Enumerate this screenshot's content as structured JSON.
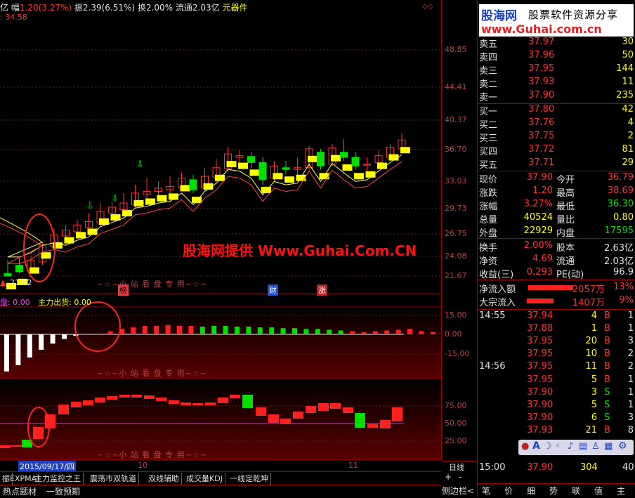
{
  "topinfo": {
    "prefix": "亿",
    "amp_label": "幅",
    "amp_value": "1.20(3.27%)",
    "zhen": "振2.39(6.51%)",
    "huan": "换2.00%",
    "liutong": "流通2.03亿",
    "sector": "元器件",
    "price_tag": ": 34.58"
  },
  "axis_main": [
    "48.85",
    "44.41",
    "40.37",
    "36.70",
    "33.03",
    "29.73",
    "26.75",
    "24.08",
    "21.67"
  ],
  "axis_mid": [
    "15.00",
    "0.00",
    "-15.00"
  ],
  "axis_low": [
    "75.00",
    "50.00",
    "25.00"
  ],
  "chart_labels": {
    "low_price": "21.02",
    "watermark1": "~☆~小 站 看 盘 专 用~☆~",
    "watermark2": "~☆~小 站 看 盘 专 用~☆~",
    "watermark3": "~☆~小 站 看 盘 专 用~☆~",
    "badge_bang": "榜",
    "badge_cai": "财",
    "badge_zhang": "涨",
    "mid_label1": "盘: 0.00",
    "mid_label2": "主力出货: 0.00",
    "ad_text": "股海网提供 Www.Guhai.Com.CN",
    "date_label": "2015/09/17/四",
    "month_10": "10",
    "month_11": "11",
    "period": "日线"
  },
  "logo": {
    "main": "股海网",
    "sub": "股票软件资源分享",
    "url": "www.Guhai.com.cn"
  },
  "asks": [
    {
      "label": "卖五",
      "price": "37.97",
      "vol": "30"
    },
    {
      "label": "卖四",
      "price": "37.96",
      "vol": "50"
    },
    {
      "label": "卖三",
      "price": "37.95",
      "vol": "144"
    },
    {
      "label": "卖二",
      "price": "37.93",
      "vol": "11"
    },
    {
      "label": "卖一",
      "price": "37.90",
      "vol": "235"
    }
  ],
  "bids": [
    {
      "label": "买一",
      "price": "37.80",
      "vol": "42"
    },
    {
      "label": "买二",
      "price": "37.76",
      "vol": "4"
    },
    {
      "label": "买三",
      "price": "37.75",
      "vol": "2"
    },
    {
      "label": "买四",
      "price": "37.72",
      "vol": "81"
    },
    {
      "label": "买五",
      "price": "37.71",
      "vol": "29"
    }
  ],
  "stats": [
    {
      "l1": "现价",
      "v1": "37.90",
      "l2": "今开",
      "v2": "36.79"
    },
    {
      "l1": "涨跌",
      "v1": "1.20",
      "l2": "最高",
      "v2": "38.69"
    },
    {
      "l1": "涨幅",
      "v1": "3.27%",
      "l2": "最低",
      "v2": "36.30"
    },
    {
      "l1": "总量",
      "v1": "40524",
      "l2": "量比",
      "v2": "0.80"
    },
    {
      "l1": "外盘",
      "v1": "22929",
      "l2": "内盘",
      "v2": "17595"
    }
  ],
  "stats2": [
    {
      "l1": "换手",
      "v1": "2.00%",
      "l2": "股本",
      "v2": "2.63亿"
    },
    {
      "l1": "净资",
      "v1": "4.69",
      "l2": "流通",
      "v2": "2.03亿"
    },
    {
      "l1": "收益(三)",
      "v1": "0.293",
      "l2": "PE(动)",
      "v2": "96.9"
    }
  ],
  "flows": [
    {
      "label": "净流入额",
      "amount": "2057万",
      "pct": "13%"
    },
    {
      "label": "大宗流入",
      "amount": "1407万",
      "pct": "9%"
    }
  ],
  "ticks": [
    {
      "time": "14:55",
      "price": "37.94",
      "vol": "4",
      "side": "B",
      "num": "1"
    },
    {
      "time": "",
      "price": "37.88",
      "vol": "1",
      "side": "B",
      "num": "1"
    },
    {
      "time": "",
      "price": "37.95",
      "vol": "20",
      "side": "B",
      "num": "3"
    },
    {
      "time": "",
      "price": "37.95",
      "vol": "10",
      "side": "B",
      "num": "2"
    },
    {
      "time": "14:56",
      "price": "37.95",
      "vol": "11",
      "side": "B",
      "num": "2"
    },
    {
      "time": "",
      "price": "37.95",
      "vol": "5",
      "side": "B",
      "num": "1"
    },
    {
      "time": "",
      "price": "37.90",
      "vol": "3",
      "side": "S",
      "num": "1"
    },
    {
      "time": "",
      "price": "37.90",
      "vol": "5",
      "side": "S",
      "num": "1"
    },
    {
      "time": "",
      "price": "37.90",
      "vol": "6",
      "side": "S",
      "num": "3"
    },
    {
      "time": "",
      "price": "37.93",
      "vol": "21",
      "side": "B",
      "num": "8"
    }
  ],
  "last_tick": {
    "time": "15:00",
    "price": "37.90",
    "vol": "304",
    "num": "40"
  },
  "tabs": [
    "振",
    "EXPMA",
    "主力监控之王",
    "震荡市双轨道",
    "双线辅助",
    "成交量KDJ",
    "一线定乾坤"
  ],
  "bottom": {
    "hot": "热点题材",
    "consensus": "一致预期",
    "side": "侧边栏<"
  },
  "panel_tabs": [
    "笔",
    "价",
    "细",
    "势",
    "联",
    "值",
    "主"
  ],
  "plus": "+",
  "minus": "-"
}
